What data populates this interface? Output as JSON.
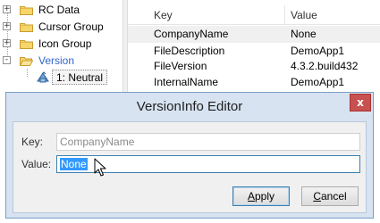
{
  "tree": {
    "items": [
      {
        "label": "RC Data",
        "expander": "+",
        "icon": "folder-icon"
      },
      {
        "label": "Cursor Group",
        "expander": "+",
        "icon": "folder-icon"
      },
      {
        "label": "Icon Group",
        "expander": "+",
        "icon": "folder-icon"
      },
      {
        "label": "Version",
        "expander": "-",
        "icon": "folder-open-icon"
      }
    ],
    "leaf": {
      "label": "1: Neutral",
      "icon": "version-resource-icon"
    }
  },
  "list": {
    "headers": {
      "key": "Key",
      "value": "Value"
    },
    "rows": [
      {
        "key": "CompanyName",
        "value": "None",
        "selected": true
      },
      {
        "key": "FileDescription",
        "value": "DemoApp1"
      },
      {
        "key": "FileVersion",
        "value": "4.3.2.build432"
      },
      {
        "key": "InternalName",
        "value": "DemoApp1"
      }
    ]
  },
  "dialog": {
    "title": "VersionInfo Editor",
    "close_label": "x",
    "key_label": "Key:",
    "key_value": "CompanyName",
    "value_label": "Value:",
    "value_value": "None",
    "apply_label_mnemonic": "A",
    "apply_label_rest": "pply",
    "cancel_label_mnemonic": "C",
    "cancel_label_rest": "ancel"
  },
  "colors": {
    "accent": "#3399ff",
    "close_button": "#c75050",
    "dialog_frame": "#d7e3f1",
    "tree_selected_text": "#3366cc"
  }
}
